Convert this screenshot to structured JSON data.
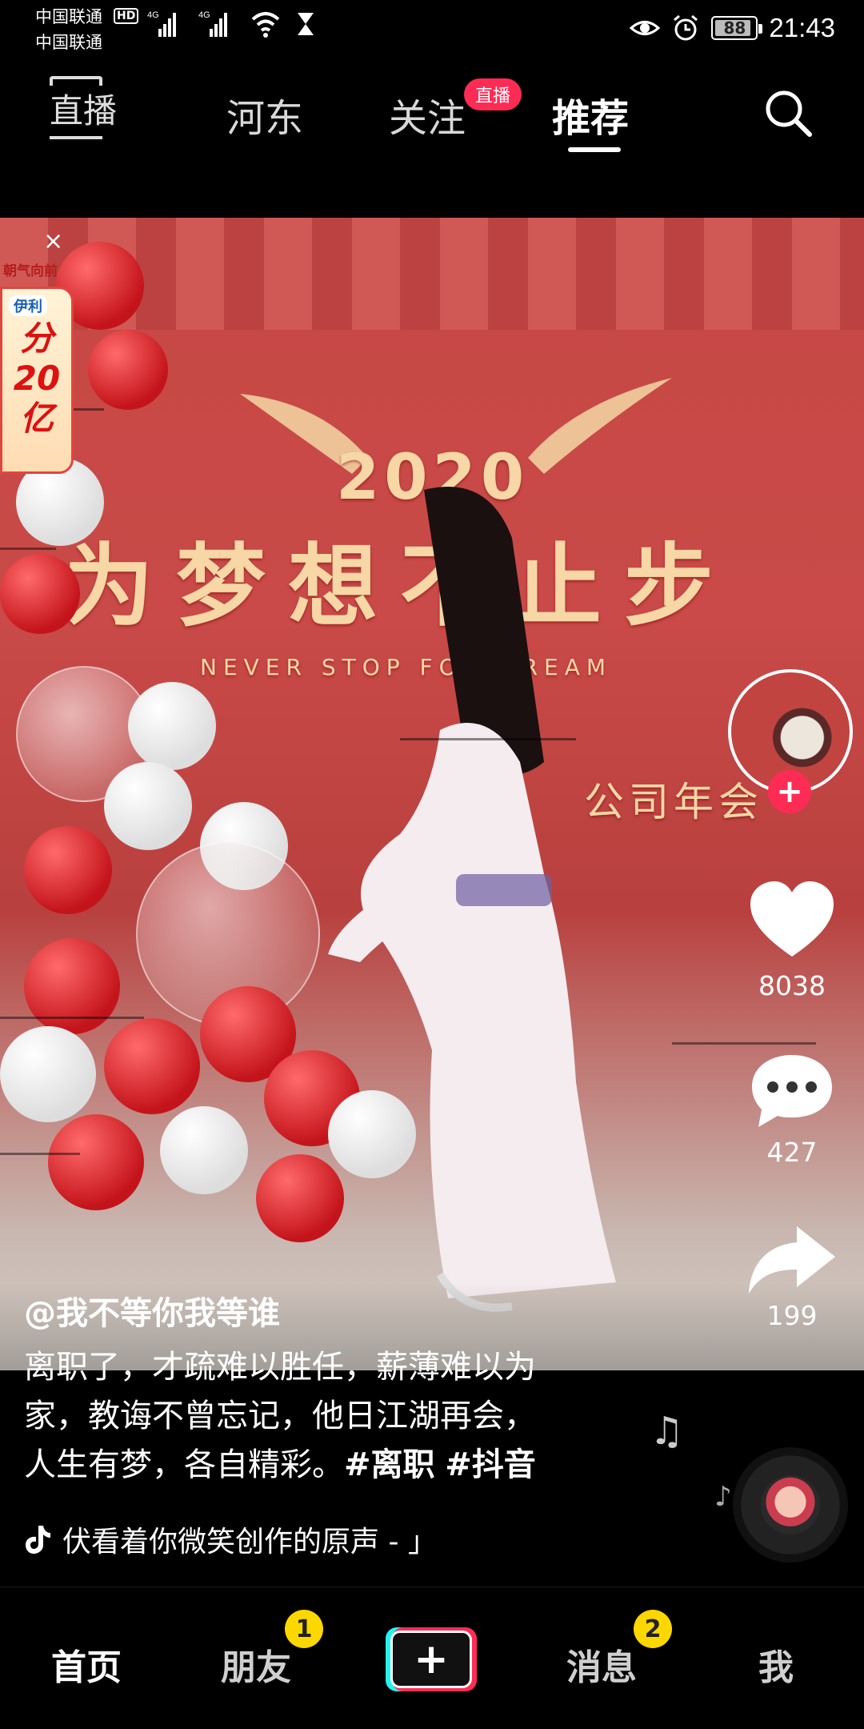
{
  "status_bar": {
    "carrier_1": "中国联通",
    "carrier_2": "中国联通",
    "hd": "HD",
    "network_1": "4G",
    "network_2": "4G",
    "battery": "88",
    "battery_level": 0.88,
    "time": "21:43"
  },
  "top_nav": {
    "live_entry": "直播",
    "tabs": [
      "河东",
      "关注",
      "推荐"
    ],
    "active_tab": "推荐",
    "follow_live_badge": "直播"
  },
  "ad": {
    "top_text": "朝气向前",
    "brand": "伊利",
    "lines": [
      "分",
      "20",
      "亿"
    ],
    "close": "×"
  },
  "video": {
    "backdrop_year": "2020",
    "backdrop_slogan": "为梦想不止步",
    "backdrop_english": "NEVER STOP FOR DREAM",
    "backdrop_event": "公司年会"
  },
  "rail": {
    "follow": "+",
    "likes": "8038",
    "comments": "427",
    "shares": "199"
  },
  "post": {
    "author": "@我不等你我等谁",
    "desc_line1": "离职了，才疏难以胜任，薪薄难以为",
    "desc_line2": "家，教诲不曾忘记，他日江湖再会，",
    "desc_line3_text": "人生有梦，各自精彩。",
    "tag1": "#离职",
    "tag2": "#抖音",
    "music": "伏看着你微笑创作的原声 - 」"
  },
  "bottom_nav": {
    "home": "首页",
    "friends": "朋友",
    "friends_badge": "1",
    "create": "+",
    "messages": "消息",
    "messages_badge": "2",
    "me": "我"
  },
  "colors": {
    "accent": "#fe2c55",
    "badge": "#fdd700",
    "cyan": "#25f4ee"
  }
}
